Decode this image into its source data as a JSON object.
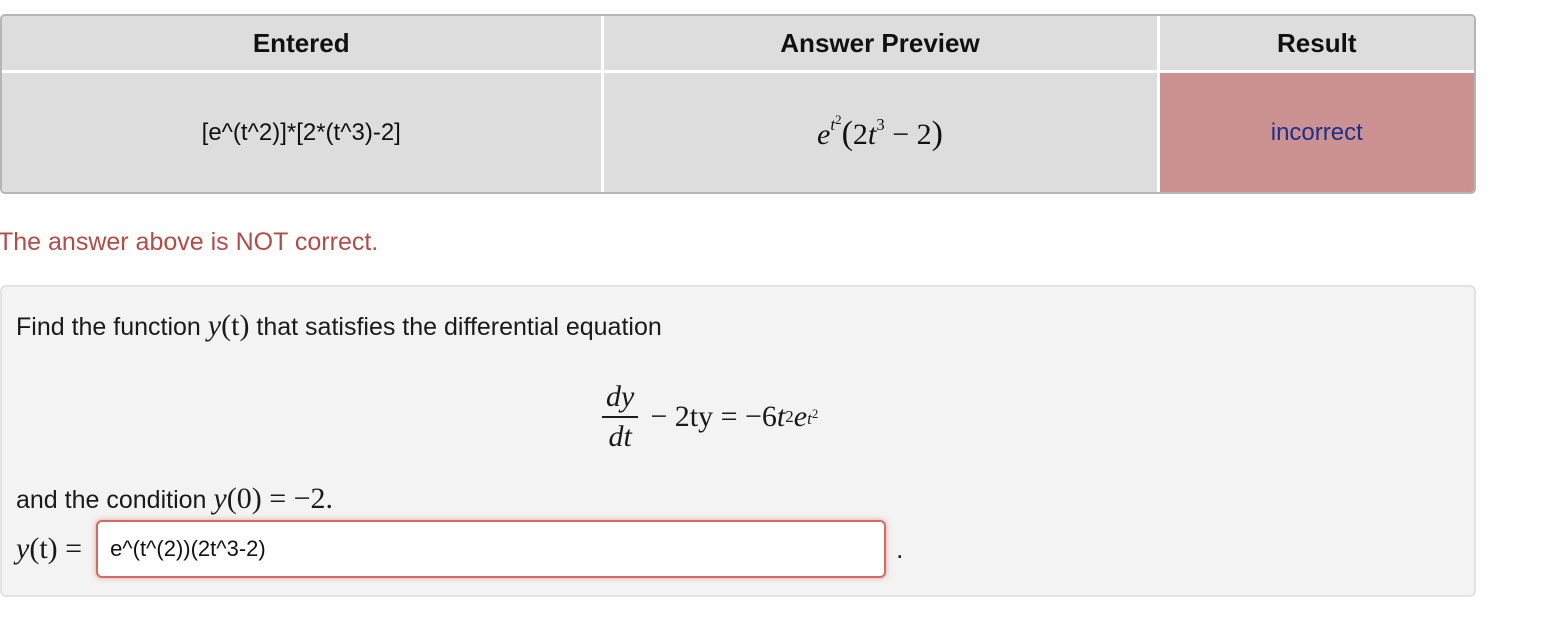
{
  "results_table": {
    "headers": {
      "entered": "Entered",
      "preview": "Answer Preview",
      "result": "Result"
    },
    "row": {
      "entered": "[e^(t^2)]*[2*(t^3)-2]",
      "preview": {
        "base": "e",
        "exp_base": "t",
        "exp_power": "2",
        "open": "(",
        "coef": "2",
        "var": "t",
        "var_power": "3",
        "minus": " − ",
        "const": "2",
        "close": ")"
      },
      "result": "incorrect",
      "result_bg_color": "#cc9191"
    }
  },
  "message": {
    "text": "The answer above is NOT correct.",
    "color": "#b14c46"
  },
  "problem": {
    "intro_before": "Find the function ",
    "intro_func": "y",
    "intro_arg": "(t)",
    "intro_after": " that satisfies the differential equation",
    "equation": {
      "numerator": "dy",
      "denominator": "dt",
      "middle": "− 2ty = −6",
      "t": "t",
      "t_power": "2",
      "e": "e",
      "e_exp_base": "t",
      "e_exp_power": "2"
    },
    "condition_before": "and the condition ",
    "condition_func": "y",
    "condition_rest": "(0) = −2.",
    "answer_label_func": "y",
    "answer_label_rest": "(t) =",
    "answer_value": "e^(t^(2))(2t^3-2)",
    "answer_period": "."
  }
}
